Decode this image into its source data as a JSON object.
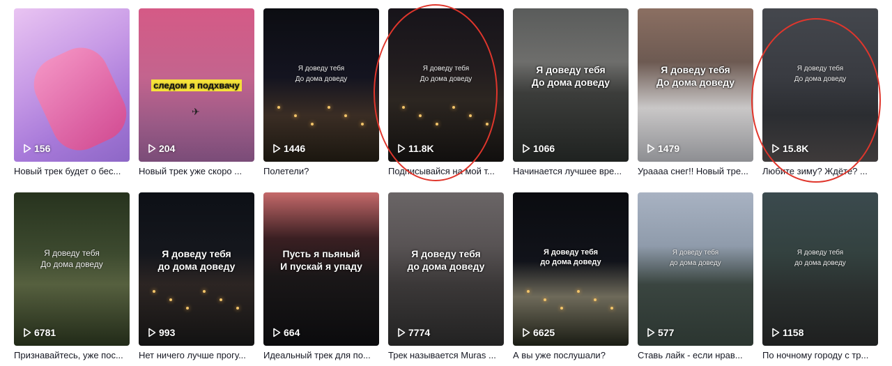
{
  "videos": [
    {
      "views": "156",
      "caption": "Новый трек будет о бес...",
      "overlay": "",
      "style": "plain",
      "bg": "linear-gradient(150deg,#e9c4f2 0%,#c79ae6 40%,#a779d9 70%,#8d67c6 100%)"
    },
    {
      "views": "204",
      "caption": "Новый трек уже скоро ...",
      "overlay": "следом я подхвачу",
      "style": "yellow",
      "bg": "linear-gradient(180deg,#d55a86 0%,#c3648e 45%,#9a5a86 75%,#7a4c78 100%)"
    },
    {
      "views": "1446",
      "caption": "Полетели?",
      "overlay": "Я доведу тебя\nДо дома доведу",
      "style": "plain",
      "bg": "linear-gradient(180deg,#0c0d12 0%,#141420 45%,#3a2d24 70%,#1a160f 100%)"
    },
    {
      "views": "11.8K",
      "caption": "Подписывайся на мой т...",
      "overlay": "Я доведу тебя\nДо дома доведу",
      "style": "plain",
      "bg": "linear-gradient(180deg,#17141a 0%,#221d1f 40%,#2c2621 60%,#110f0e 100%)"
    },
    {
      "views": "1066",
      "caption": "Начинается лучшее вре...",
      "overlay": "Я доведу тебя\nДо дома доведу",
      "style": "bold",
      "bg": "linear-gradient(180deg,#5a5c5b 0%,#6e6e6c 35%,#3c3d3b 55%,#1f2220 100%)"
    },
    {
      "views": "1479",
      "caption": "Ураааа снег!! Новый тре...",
      "overlay": "Я доведу тебя\nДо дома доведу",
      "style": "bold",
      "bg": "linear-gradient(180deg,#8b6f62 0%,#6d5a52 35%,#c9c7c7 65%,#8d8e92 100%)"
    },
    {
      "views": "15.8K",
      "caption": "Любите зиму? Ждёте? ...",
      "overlay": "Я доведу тебя\nДо дома доведу",
      "style": "plain",
      "bg": "linear-gradient(180deg,#44474d 0%,#393b41 45%,#2b2d31 70%,#3e3a3a 100%)"
    },
    {
      "views": "6781",
      "caption": "Признавайтесь, уже пос...",
      "overlay": "Я доведу тебя\nДо дома доведу",
      "style": "plain-lg",
      "bg": "linear-gradient(180deg,#27331e 0%,#3d4a2f 40%,#56603f 60%,#212a18 100%)"
    },
    {
      "views": "993",
      "caption": "Нет ничего лучше прогу...",
      "overlay": "Я доведу тебя\nдо дома доведу",
      "style": "bold",
      "bg": "linear-gradient(180deg,#0d1016 0%,#15171d 40%,#2c2523 60%,#121212 100%)"
    },
    {
      "views": "664",
      "caption": "Идеальный трек для по...",
      "overlay": "Пусть я пьяный\nИ пускай я упаду",
      "style": "bold",
      "bg": "linear-gradient(180deg,#c5696a 0%,#3a1f22 30%,#1a1718 55%,#0b0b0d 100%)"
    },
    {
      "views": "7774",
      "caption": "Трек называется Muras ...",
      "overlay": "Я доведу тебя\nдо дома доведу",
      "style": "bold",
      "bg": "linear-gradient(180deg,#6a6566 0%,#585354 35%,#3b3838 60%,#222222 100%)"
    },
    {
      "views": "6625",
      "caption": "А вы уже послушали?",
      "overlay": "Я доведу тебя\nдо дома доведу",
      "style": "bold-sm",
      "bg": "linear-gradient(180deg,#0b0c10 0%,#11131a 45%,#6e6a5a 68%,#1a1c14 100%)"
    },
    {
      "views": "577",
      "caption": "Ставь лайк - если нрав...",
      "overlay": "Я доведу тебя\nдо дома доведу",
      "style": "plain",
      "bg": "linear-gradient(180deg,#a8b2c2 0%,#8f9bab 35%,#3a4540 60%,#2b3530 100%)"
    },
    {
      "views": "1158",
      "caption": "По ночному городу с тр...",
      "overlay": "Я доведу тебя\nдо дома доведу",
      "style": "plain",
      "bg": "linear-gradient(180deg,#3b4a4e 0%,#33413f 40%,#2a2f2e 65%,#1e1f1f 100%)"
    }
  ],
  "highlight_color": "#e0362c"
}
